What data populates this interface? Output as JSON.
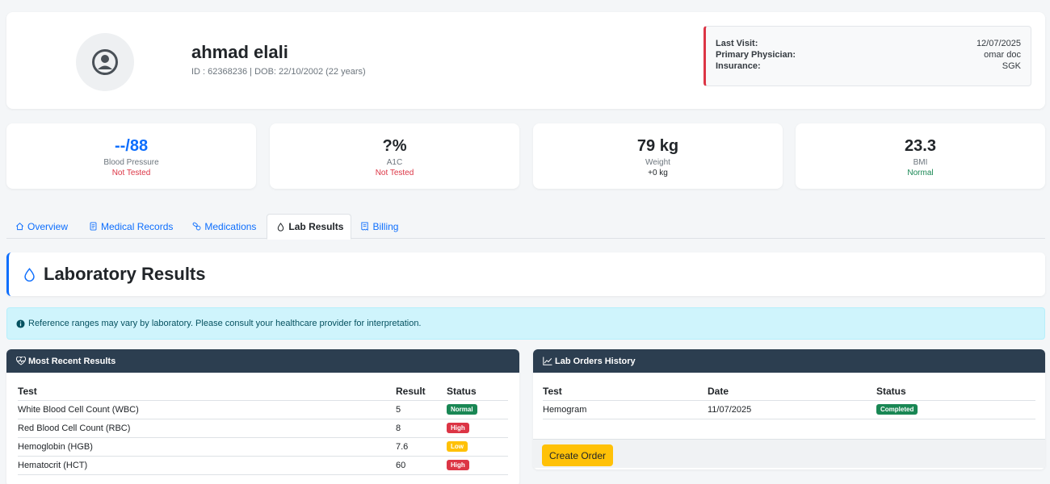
{
  "patient": {
    "name": "ahmad elali",
    "sub": "ID : 62368236 | DOB: 22/10/2002 (22 years)",
    "info": [
      {
        "label": "Last Visit:",
        "value": "12/07/2025"
      },
      {
        "label": "Primary Physician:",
        "value": "omar doc"
      },
      {
        "label": "Insurance:",
        "value": "SGK"
      }
    ]
  },
  "stats": [
    {
      "value": "--/88",
      "label": "Blood Pressure",
      "sub": "Not Tested",
      "value_color": "#0d6efd",
      "sub_color": "#dc3545"
    },
    {
      "value": "?%",
      "label": "A1C",
      "sub": "Not Tested",
      "value_color": "#212529",
      "sub_color": "#dc3545"
    },
    {
      "value": "79 kg",
      "label": "Weight",
      "sub": "+0 kg",
      "value_color": "#212529",
      "sub_color": "#212529"
    },
    {
      "value": "23.3",
      "label": "BMI",
      "sub": "Normal",
      "value_color": "#212529",
      "sub_color": "#198754"
    }
  ],
  "tabs": [
    {
      "label": "Overview",
      "icon": "home-icon"
    },
    {
      "label": "Medical Records",
      "icon": "file-icon"
    },
    {
      "label": "Medications",
      "icon": "pills-icon"
    },
    {
      "label": "Lab Results",
      "icon": "droplet-icon",
      "active": true
    },
    {
      "label": "Billing",
      "icon": "receipt-icon"
    }
  ],
  "section": {
    "title": "Laboratory Results"
  },
  "alert": {
    "text": "Reference ranges may vary by laboratory. Please consult your healthcare provider for interpretation."
  },
  "recent": {
    "title": "Most Recent Results",
    "columns": [
      "Test",
      "Result",
      "Status"
    ],
    "rows": [
      {
        "test": "White Blood Cell Count (WBC)",
        "result": "5",
        "status": "Normal"
      },
      {
        "test": "Red Blood Cell Count (RBC)",
        "result": "8",
        "status": "High"
      },
      {
        "test": "Hemoglobin (HGB)",
        "result": "7.6",
        "status": "Low"
      },
      {
        "test": "Hematocrit (HCT)",
        "result": "60",
        "status": "High"
      }
    ]
  },
  "orders": {
    "title": "Lab Orders History",
    "columns": [
      "Test",
      "Date",
      "Status"
    ],
    "rows": [
      {
        "test": "Hemogram",
        "date": "11/07/2025",
        "status": "Completed"
      }
    ],
    "button": "Create Order"
  },
  "colors": {
    "accent": "#0d6efd",
    "header_dark": "#2c3e50",
    "danger": "#dc3545",
    "success": "#198754",
    "warning": "#ffc107"
  }
}
